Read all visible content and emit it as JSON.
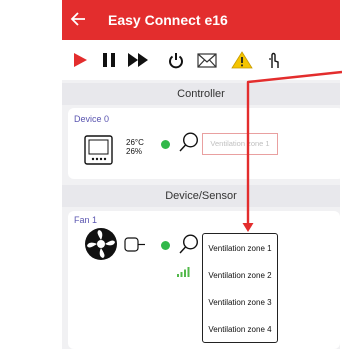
{
  "appbar": {
    "back_icon": "arrow-left-icon",
    "title": "Easy Connect e16"
  },
  "toolbar": {
    "icons": [
      "play-icon",
      "pause-icon",
      "fast-forward-icon",
      "power-icon",
      "mail-icon",
      "warning-icon",
      "touch-icon"
    ],
    "colors": {
      "play": "#e32d2d",
      "warning": "#f4c400"
    }
  },
  "controller": {
    "section_label": "Controller",
    "device_label": "Device 0",
    "temperature": "26°C",
    "humidity": "26%",
    "zone_value": "Ventilation zone 1"
  },
  "sensor": {
    "section_label": "Device/Sensor",
    "device_label": "Fan 1",
    "zone_options": [
      "Ventilation zone 1",
      "Ventilation zone 2",
      "Ventilation zone 3",
      "Ventilation zone 4"
    ]
  },
  "colors": {
    "accent": "#e32d2d",
    "status_green": "#31b84a",
    "link_purple": "#5a55b0"
  }
}
